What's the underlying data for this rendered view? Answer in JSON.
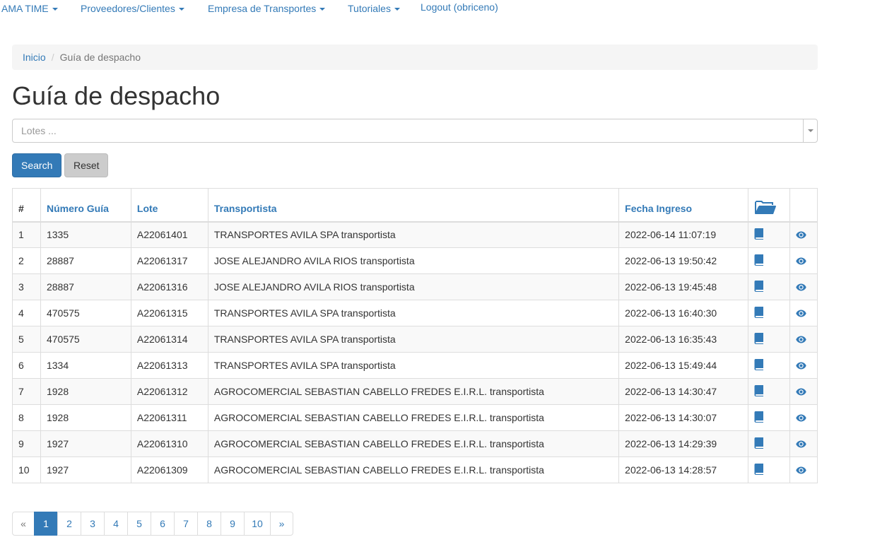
{
  "nav": {
    "items": [
      {
        "label": "AMA TIME",
        "dropdown": true
      },
      {
        "label": "Proveedores/Clientes",
        "dropdown": true
      },
      {
        "label": "Empresa de Transportes",
        "dropdown": true
      },
      {
        "label": "Tutoriales",
        "dropdown": true
      },
      {
        "label": "Logout (obriceno)",
        "dropdown": false
      }
    ]
  },
  "breadcrumb": {
    "home": "Inicio",
    "current": "Guía de despacho"
  },
  "page_title": "Guía de despacho",
  "filter": {
    "placeholder": "Lotes ..."
  },
  "buttons": {
    "search": "Search",
    "reset": "Reset"
  },
  "table": {
    "headers": {
      "num": "#",
      "numero_guia": "Número Guía",
      "lote": "Lote",
      "transportista": "Transportista",
      "fecha_ingreso": "Fecha Ingreso"
    },
    "rows": [
      {
        "num": "1",
        "numero_guia": "1335",
        "lote": "A22061401",
        "transportista": "TRANSPORTES AVILA SPA transportista",
        "fecha_ingreso": "2022-06-14 11:07:19"
      },
      {
        "num": "2",
        "numero_guia": "28887",
        "lote": "A22061317",
        "transportista": "JOSE ALEJANDRO AVILA RIOS transportista",
        "fecha_ingreso": "2022-06-13 19:50:42"
      },
      {
        "num": "3",
        "numero_guia": "28887",
        "lote": "A22061316",
        "transportista": "JOSE ALEJANDRO AVILA RIOS transportista",
        "fecha_ingreso": "2022-06-13 19:45:48"
      },
      {
        "num": "4",
        "numero_guia": "470575",
        "lote": "A22061315",
        "transportista": "TRANSPORTES AVILA SPA transportista",
        "fecha_ingreso": "2022-06-13 16:40:30"
      },
      {
        "num": "5",
        "numero_guia": "470575",
        "lote": "A22061314",
        "transportista": "TRANSPORTES AVILA SPA transportista",
        "fecha_ingreso": "2022-06-13 16:35:43"
      },
      {
        "num": "6",
        "numero_guia": "1334",
        "lote": "A22061313",
        "transportista": "TRANSPORTES AVILA SPA transportista",
        "fecha_ingreso": "2022-06-13 15:49:44"
      },
      {
        "num": "7",
        "numero_guia": "1928",
        "lote": "A22061312",
        "transportista": "AGROCOMERCIAL SEBASTIAN CABELLO FREDES E.I.R.L. transportista",
        "fecha_ingreso": "2022-06-13 14:30:47"
      },
      {
        "num": "8",
        "numero_guia": "1928",
        "lote": "A22061311",
        "transportista": "AGROCOMERCIAL SEBASTIAN CABELLO FREDES E.I.R.L. transportista",
        "fecha_ingreso": "2022-06-13 14:30:07"
      },
      {
        "num": "9",
        "numero_guia": "1927",
        "lote": "A22061310",
        "transportista": "AGROCOMERCIAL SEBASTIAN CABELLO FREDES E.I.R.L. transportista",
        "fecha_ingreso": "2022-06-13 14:29:39"
      },
      {
        "num": "10",
        "numero_guia": "1927",
        "lote": "A22061309",
        "transportista": "AGROCOMERCIAL SEBASTIAN CABELLO FREDES E.I.R.L. transportista",
        "fecha_ingreso": "2022-06-13 14:28:57"
      }
    ]
  },
  "pagination": {
    "prev": "«",
    "pages": [
      "1",
      "2",
      "3",
      "4",
      "5",
      "6",
      "7",
      "8",
      "9",
      "10"
    ],
    "active": "1",
    "next": "»"
  },
  "icons": {
    "header_action": "folder-open-icon",
    "row_action_1": "book-icon",
    "row_action_2": "eye-icon"
  },
  "colors": {
    "link": "#337ab7",
    "primary": "#337ab7",
    "reset_button": "#cccccc",
    "breadcrumb_bg": "#f5f5f5"
  }
}
